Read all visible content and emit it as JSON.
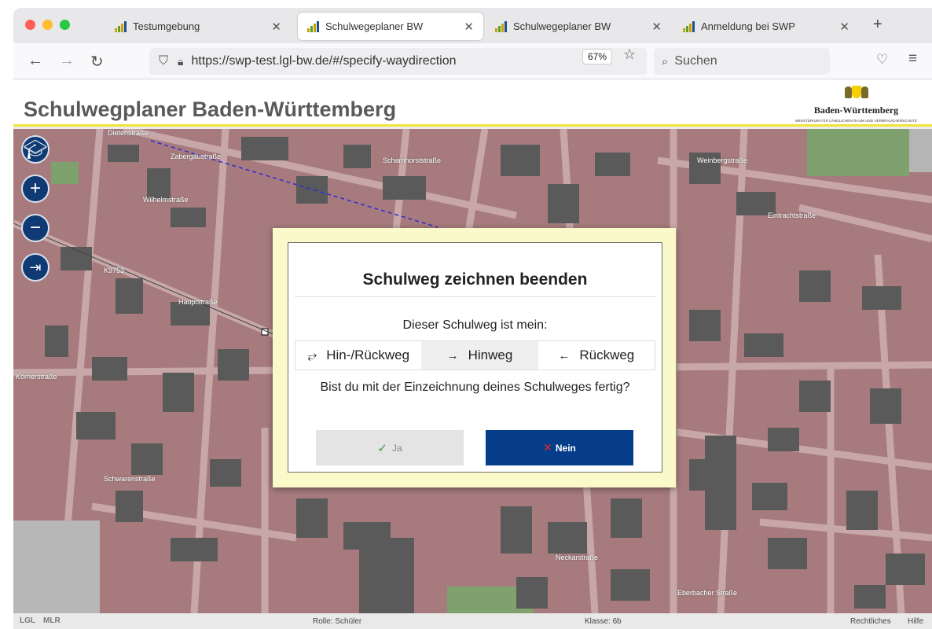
{
  "browser": {
    "tabs": [
      {
        "title": "Testumgebung",
        "active": false
      },
      {
        "title": "Schulwegeplaner BW",
        "active": true
      },
      {
        "title": "Schulwegeplaner BW",
        "active": false
      },
      {
        "title": "Anmeldung bei SWP",
        "active": false
      }
    ],
    "new_tab": "+",
    "url": "https://swp-test.lgl-bw.de/#/specify-waydirection",
    "zoom": "67%",
    "search_placeholder": "Suchen"
  },
  "app": {
    "title": "Schulwegplaner Baden-Württemberg",
    "logo_name": "Baden-Württemberg",
    "logo_sub": "MINISTERIUM FÜR LÄNDLICHEN RAUM UND VERBRAUCHERSCHUTZ"
  },
  "map": {
    "street_labels": [
      "Dietenstraße",
      "Zabergäustraße",
      "Scharnhorststraße",
      "Weinbergstraße",
      "Eintrachtstraße",
      "K9753",
      "Hauptstraße",
      "Körnerstraße",
      "Neckarstraße",
      "Eberbacher Straße",
      "Wilhelmstraße",
      "Schwarenstraße"
    ]
  },
  "dialog": {
    "title": "Schulweg zeichnen beenden",
    "subtitle": "Dieser Schulweg ist mein:",
    "options": [
      {
        "icon": "⥂",
        "label": "Hin-/Rückweg",
        "active": false
      },
      {
        "icon": "→",
        "label": "Hinweg",
        "active": true
      },
      {
        "icon": "←",
        "label": "Rückweg",
        "active": false
      }
    ],
    "question": "Bist du mit der Einzeichnung deines Schulweges fertig?",
    "yes_label": "Ja",
    "no_label": "Nein"
  },
  "footer": {
    "lgl": "LGL",
    "mlr": "MLR",
    "role": "Rolle: Schüler",
    "klasse": "Klasse: 6b",
    "rechtliches": "Rechtliches",
    "hilfe": "Hilfe"
  },
  "colors": {
    "accent_blue": "#063d8a",
    "header_stripe": "#f2e33b",
    "map_bg": "#a77b7d"
  }
}
